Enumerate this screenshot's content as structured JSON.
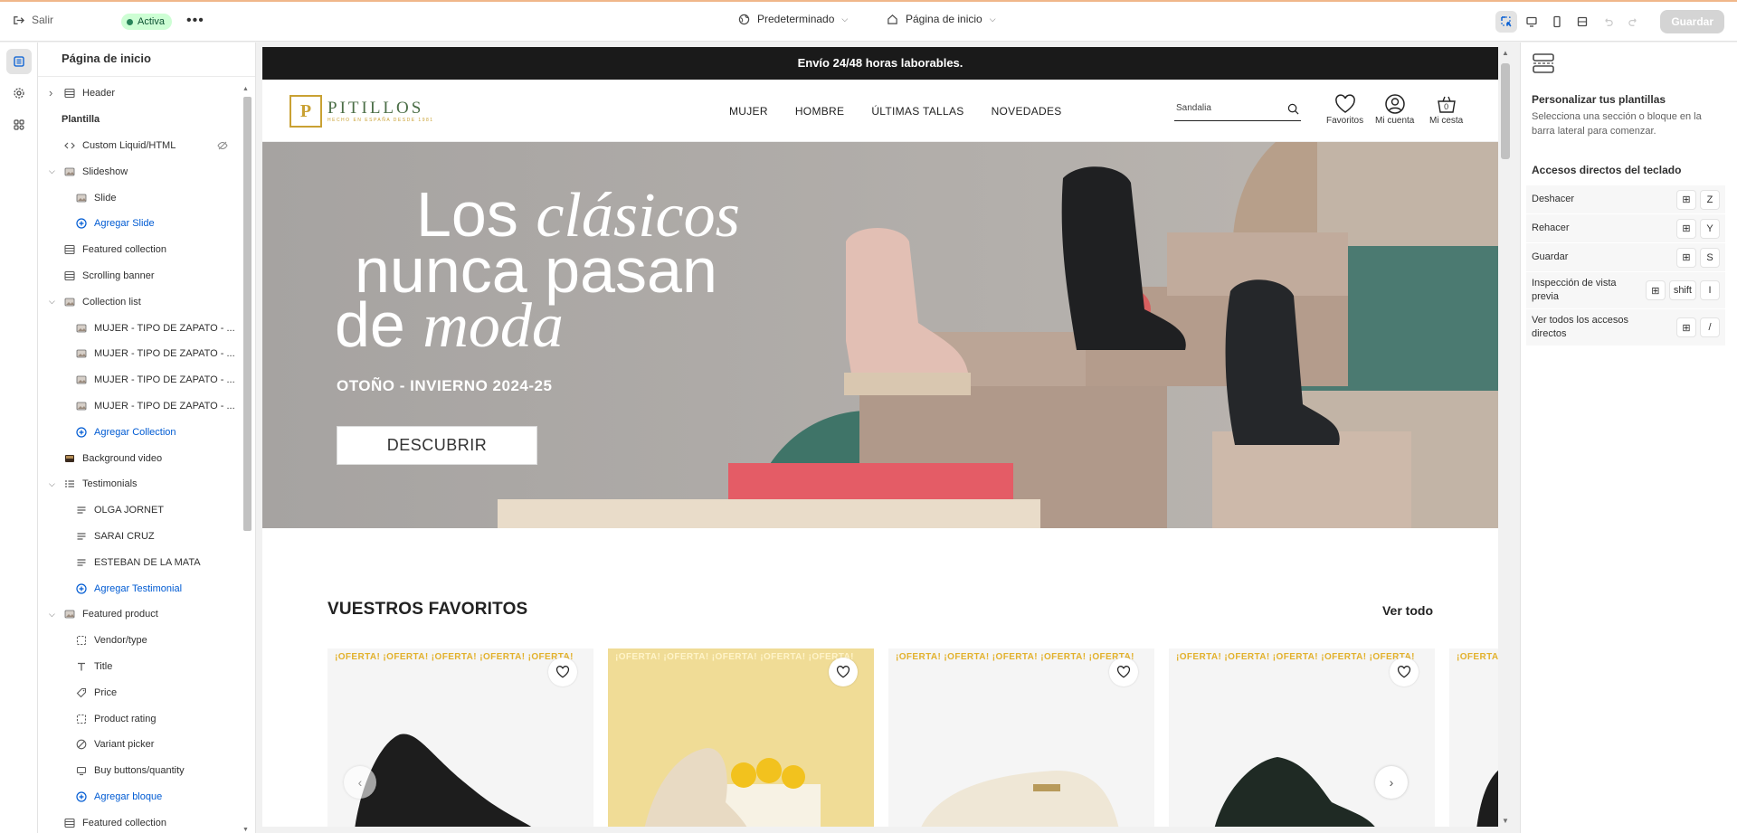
{
  "topbar": {
    "exit_label": "Salir",
    "status_badge": "Activa",
    "theme_selector": "Predeterminado",
    "page_selector": "Página de inicio",
    "save_label": "Guardar"
  },
  "sidebar": {
    "title": "Página de inicio",
    "items": [
      {
        "label": "Header",
        "level": 1,
        "icon": "section-icon",
        "chevron": "right"
      },
      {
        "label": "Plantilla",
        "level": 0,
        "group": true
      },
      {
        "label": "Custom Liquid/HTML",
        "level": 1,
        "icon": "code-icon",
        "hidden": true
      },
      {
        "label": "Slideshow",
        "level": 1,
        "icon": "image-icon",
        "chevron": "down"
      },
      {
        "label": "Slide",
        "level": 2,
        "icon": "image-icon"
      },
      {
        "label": "Agregar Slide",
        "level": 2,
        "icon": "add-circle-icon",
        "add": true
      },
      {
        "label": "Featured collection",
        "level": 1,
        "icon": "section-icon"
      },
      {
        "label": "Scrolling banner",
        "level": 1,
        "icon": "section-icon"
      },
      {
        "label": "Collection list",
        "level": 1,
        "icon": "image-icon",
        "chevron": "down"
      },
      {
        "label": "MUJER - TIPO DE ZAPATO - ...",
        "level": 2,
        "icon": "image-icon"
      },
      {
        "label": "MUJER - TIPO DE ZAPATO - ...",
        "level": 2,
        "icon": "image-icon"
      },
      {
        "label": "MUJER - TIPO DE ZAPATO - ...",
        "level": 2,
        "icon": "image-icon"
      },
      {
        "label": "MUJER - TIPO DE ZAPATO - ...",
        "level": 2,
        "icon": "image-icon"
      },
      {
        "label": "Agregar Collection",
        "level": 2,
        "icon": "add-circle-icon",
        "add": true
      },
      {
        "label": "Background video",
        "level": 1,
        "icon": "video-icon"
      },
      {
        "label": "Testimonials",
        "level": 1,
        "icon": "list-icon",
        "chevron": "down"
      },
      {
        "label": "OLGA JORNET",
        "level": 2,
        "icon": "text-lines-icon"
      },
      {
        "label": "SARAI CRUZ",
        "level": 2,
        "icon": "text-lines-icon"
      },
      {
        "label": "ESTEBAN DE LA MATA",
        "level": 2,
        "icon": "text-lines-icon"
      },
      {
        "label": "Agregar Testimonial",
        "level": 2,
        "icon": "add-circle-icon",
        "add": true
      },
      {
        "label": "Featured product",
        "level": 1,
        "icon": "image-icon",
        "chevron": "down"
      },
      {
        "label": "Vendor/type",
        "level": 2,
        "icon": "dashed-box-icon"
      },
      {
        "label": "Title",
        "level": 2,
        "icon": "text-t-icon"
      },
      {
        "label": "Price",
        "level": 2,
        "icon": "price-tag-icon"
      },
      {
        "label": "Product rating",
        "level": 2,
        "icon": "dashed-box-icon"
      },
      {
        "label": "Variant picker",
        "level": 2,
        "icon": "variant-icon"
      },
      {
        "label": "Buy buttons/quantity",
        "level": 2,
        "icon": "cart-icon"
      },
      {
        "label": "Agregar bloque",
        "level": 2,
        "icon": "add-circle-icon",
        "add": true
      },
      {
        "label": "Featured collection",
        "level": 1,
        "icon": "section-icon"
      }
    ]
  },
  "store": {
    "announcement": "Envío 24/48 horas laborables.",
    "logo_text": "PITILLOS",
    "logo_tagline": "HECHO EN ESPAÑA DESDE 1981",
    "nav": [
      "MUJER",
      "HOMBRE",
      "ÚLTIMAS TALLAS",
      "NOVEDADES"
    ],
    "search_placeholder": "Sandalia",
    "favorites_label": "Favoritos",
    "account_label": "Mi cuenta",
    "cart_label": "Mi cesta",
    "cart_count": "0",
    "hero": {
      "line1_plain": "Los ",
      "line1_italic": "clásicos",
      "line2": "nunca pasan",
      "line3_plain": "de ",
      "line3_italic": "moda",
      "season": "OTOÑO - INVIERNO 2024-25",
      "cta": "DESCUBRIR"
    },
    "favorites_section": {
      "title": "VUESTROS FAVORITOS",
      "see_all": "Ver todo",
      "offer_label": "¡OFERTA!  ¡OFERTA!  ¡OFERTA!  ¡OFERTA!  ¡OFERTA!"
    }
  },
  "right_panel": {
    "title": "Personalizar tus plantillas",
    "description": "Selecciona una sección o bloque en la barra lateral para comenzar.",
    "shortcuts_title": "Accesos directos del teclado",
    "shortcuts": [
      {
        "label": "Deshacer",
        "keys": [
          "⊞",
          "Z"
        ]
      },
      {
        "label": "Rehacer",
        "keys": [
          "⊞",
          "Y"
        ]
      },
      {
        "label": "Guardar",
        "keys": [
          "⊞",
          "S"
        ]
      },
      {
        "label": "Inspección de vista previa",
        "keys": [
          "⊞",
          "shift",
          "I"
        ]
      },
      {
        "label": "Ver todos los accesos directos",
        "keys": [
          "⊞",
          "/"
        ]
      }
    ]
  },
  "colors": {
    "accent": "#005bd3",
    "badge_bg": "#cdfed4",
    "brand_gold": "#c9a133",
    "brand_green": "#4b6e47",
    "offer_yellow": "#e2b12c"
  }
}
